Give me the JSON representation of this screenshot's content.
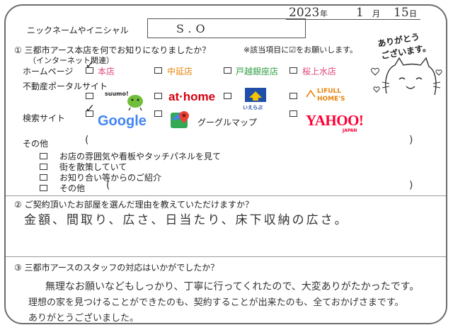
{
  "date": {
    "year": "2023",
    "year_unit": "年",
    "month": "1",
    "month_unit": "月",
    "day": "15",
    "day_unit": "日"
  },
  "nickname": {
    "label": "ニックネームやイニシャル",
    "value": "S.O"
  },
  "thanks_stamp": {
    "line1": "ありがとう",
    "line2": "ございます。"
  },
  "q1": {
    "label": "① 三都市アース本店を何でお知りになりましたか？",
    "sub": "（インターネット関連）",
    "note": "※該当項目に☑をお願いします。",
    "homepage_label": "ホームページ",
    "homepage_options": [
      {
        "label": "本店",
        "checked": true
      },
      {
        "label": "中延店",
        "checked": false
      },
      {
        "label": "戸越銀座店",
        "checked": false
      },
      {
        "label": "桜上水店",
        "checked": false
      }
    ],
    "portal_label": "不動産ポータルサイト",
    "portal_options": [
      {
        "label": "suumo!",
        "checked": false
      },
      {
        "label": "at·home",
        "checked": false
      },
      {
        "label": "いえらぶ",
        "checked": false
      },
      {
        "label": "LIFULL HOME'S",
        "checked": false
      }
    ],
    "search_label": "検索サイト",
    "search_options": [
      {
        "label": "Google",
        "checked": true
      },
      {
        "label": "グーグルマップ",
        "checked": false
      },
      {
        "label": "YAHOO!",
        "sub": "JAPAN",
        "checked": false
      }
    ],
    "other_label": "その他",
    "other_items": [
      {
        "label": "お店の雰囲気や看板やタッチパネルを見て",
        "checked": false
      },
      {
        "label": "街を散策していて",
        "checked": false
      },
      {
        "label": "お知り合い等からのご紹介",
        "checked": false
      },
      {
        "label": "その他",
        "checked": false
      }
    ]
  },
  "q2": {
    "label": "② ご契約頂いたお部屋を選んだ理由を教えていただけますか？",
    "answer": "金額、間取り、広さ、日当たり、床下収納の広さ。"
  },
  "q3": {
    "label": "③ 三都市アースのスタッフの対応はいかがでしたか？",
    "answer_lines": [
      "無理なお願いなどもしっかり、丁寧に行ってくれたので、大変ありがたかったです。",
      "理想の家を見つけることができたのも、契約することが出来たのも、全ておかげさまです。",
      "ありがとうございました。"
    ]
  },
  "colors": {
    "check": "#333333",
    "accent_green": "#2f9e44",
    "accent_orange": "#e8840c",
    "accent_pink": "#e0457b",
    "google_blue": "#4285F4",
    "google_red": "#EA4335",
    "google_yellow": "#FBBC05",
    "google_green": "#34A853",
    "yahoo_red": "#ff0033",
    "athome_red": "#d7000f"
  },
  "icons": [
    "checkbox-icon",
    "check-mark-icon",
    "cat-mascot-icon",
    "heart-icon",
    "google-maps-icon",
    "suumo-mascot-icon",
    "ierabu-house-icon",
    "lifull-logo-icon"
  ]
}
